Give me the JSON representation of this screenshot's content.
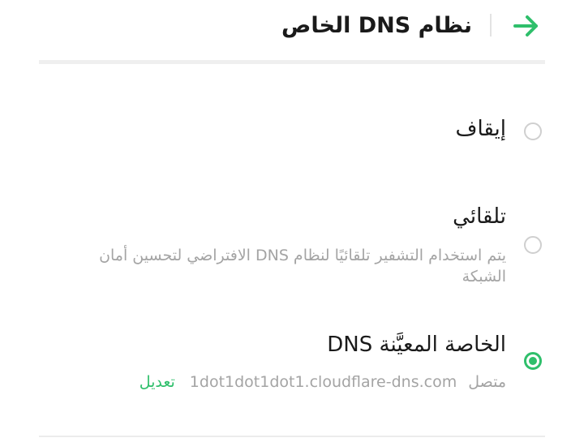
{
  "header": {
    "title": "نظام DNS الخاص",
    "back_icon": "arrow-right-icon",
    "accent_color": "#2fbf6b"
  },
  "options": [
    {
      "id": "off",
      "title": "إيقاف",
      "selected": false
    },
    {
      "id": "auto",
      "title": "تلقائي",
      "description": "يتم استخدام التشفير تلقائيًا لنظام DNS الافتراضي لتحسين أمان الشبكة",
      "selected": false
    },
    {
      "id": "custom",
      "title": "الخاصة المعيَّنة DNS",
      "status": "متصل",
      "hostname": "1dot1dot1dot1.cloudflare-dns.com",
      "edit_label": "تعديل",
      "selected": true
    }
  ]
}
